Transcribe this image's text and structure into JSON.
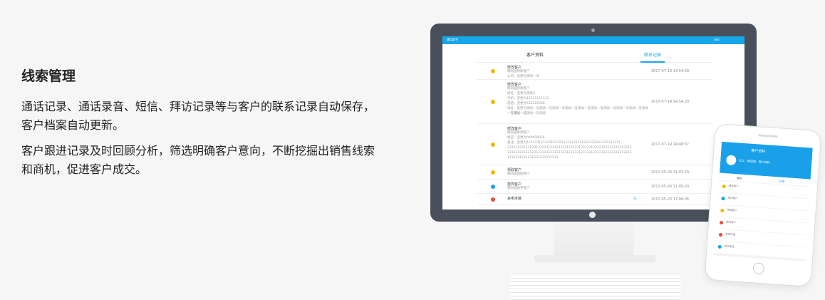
{
  "section": {
    "title": "线索管理",
    "paragraphs": [
      "通话记录、通话录音、短信、拜访记录等与客户的联系记录自动保存，客户档案自动更新。",
      "客户跟进记录及时回顾分析，筛选明确客户意向，不断挖掘出销售线索和商机，促进客户成交。"
    ]
  },
  "desktop_app": {
    "brand": "通话助手",
    "user": "test",
    "tabs": [
      "客户资料",
      "联系记录"
    ],
    "active_tab": "联系记录",
    "records": [
      {
        "icon": "person-icon",
        "color": "#f5b800",
        "title": "修改客户",
        "lines": [
          "韩同国修改客户",
          "公司：变更为测试一号"
        ],
        "time": "2017-07-19 14:54:39"
      },
      {
        "icon": "person-icon",
        "color": "#f5b800",
        "title": "修改客户",
        "lines": [
          "韩同国修改客户",
          "姓名：变更为测试3",
          "手机：变更为15111111111",
          "电话：变更为512321566",
          "地址：变更为测试一号测试一号测试一号测试一号测试一号测试一号测试一号测试一号测试一号测试一号测试一号测试一号测试",
          "一号测试一号"
        ],
        "time": "2017-07-19 14:54:20"
      },
      {
        "icon": "person-icon",
        "color": "#f5b800",
        "title": "修改客户",
        "lines": [
          "韩同国修改客户",
          "姓名：变更为fsf4608016",
          "备注：变更为1231231231231231231231231231231231231231231231",
          "2312312312312312312312312312312312312312312312312312312312312",
          "2312312312312312312312312312312312312312312312312312312312312",
          "1231231231231231231231231"
        ],
        "time": "2017-07-19 14:48:57"
      },
      {
        "icon": "person-icon",
        "color": "#f5b800",
        "title": "领取客户",
        "lines": [
          "韩同国领取客户"
        ],
        "time": "2017-05-24 11:07:23"
      },
      {
        "icon": "person-icon",
        "color": "#16a7e8",
        "title": "放弃客户",
        "lines": [
          "韩同国放弃客户"
        ],
        "time": "2017-05-24 11:05:20"
      },
      {
        "icon": "phone-icon",
        "color": "#e74c3c",
        "title": "来电未接",
        "lines": [],
        "time": "2017-05-23 17:06:05"
      }
    ]
  },
  "mobile_app": {
    "title": "客户资料",
    "subtitle": "员工 · 韩同国 · 客户资料",
    "tabs": [
      "资料",
      "记录"
    ],
    "rows": [
      "通话客户",
      "修改客户",
      "领取客户",
      "放弃客户",
      "来电未接",
      "拨出电话"
    ]
  }
}
